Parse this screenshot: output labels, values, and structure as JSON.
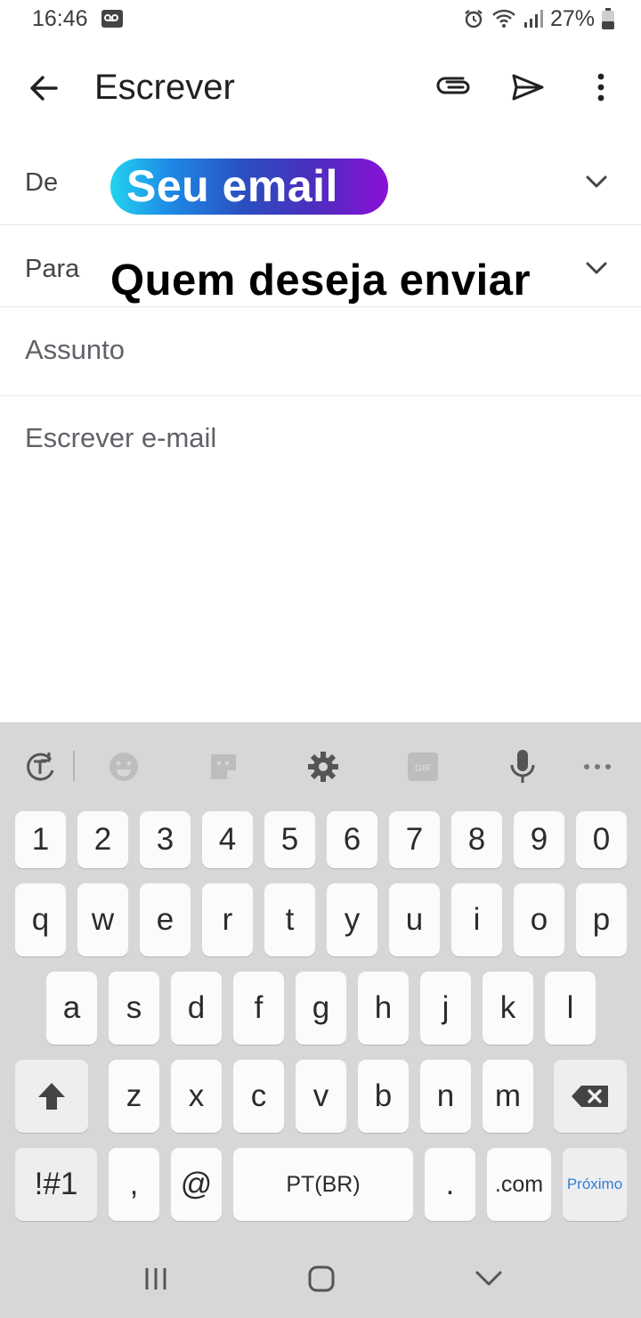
{
  "status_bar": {
    "time": "16:46",
    "battery": "27%",
    "icons": [
      "voicemail-icon",
      "alarm-icon",
      "wifi-icon",
      "signal-icon",
      "battery-icon"
    ]
  },
  "app_bar": {
    "title": "Escrever",
    "icons": [
      "back-arrow-icon",
      "paperclip-icon",
      "send-icon",
      "more-vert-icon"
    ]
  },
  "compose": {
    "from_label": "De",
    "from_value": "Seu email",
    "to_label": "Para",
    "to_value": "Quem deseja enviar",
    "subject_placeholder": "Assunto",
    "body_placeholder": "Escrever e-mail"
  },
  "keyboard": {
    "toolbar_icons": [
      "text-mode-icon",
      "emoji-icon",
      "sticker-icon",
      "settings-gear-icon",
      "gif-icon",
      "microphone-icon",
      "more-horiz-icon"
    ],
    "gif_label": "GIF",
    "number_row": [
      "1",
      "2",
      "3",
      "4",
      "5",
      "6",
      "7",
      "8",
      "9",
      "0"
    ],
    "row1": [
      "q",
      "w",
      "e",
      "r",
      "t",
      "y",
      "u",
      "i",
      "o",
      "p"
    ],
    "row2": [
      "a",
      "s",
      "d",
      "f",
      "g",
      "h",
      "j",
      "k",
      "l"
    ],
    "row3": [
      "z",
      "x",
      "c",
      "v",
      "b",
      "n",
      "m"
    ],
    "bottom": {
      "symbols": "!#1",
      "comma": ",",
      "at": "@",
      "space": "PT(BR)",
      "period": ".",
      "dotcom": ".com",
      "next": "Próximo"
    }
  },
  "nav_bar": {
    "icons": [
      "recents-icon",
      "home-icon",
      "back-down-icon"
    ]
  },
  "colors": {
    "keyboard_bg": "#d7d7d9",
    "key_bg": "#fbfbfb",
    "next_key_text": "#2f7fd4",
    "from_pill_gradient_start": "#22d3f0",
    "from_pill_gradient_end": "#8a10d6"
  }
}
